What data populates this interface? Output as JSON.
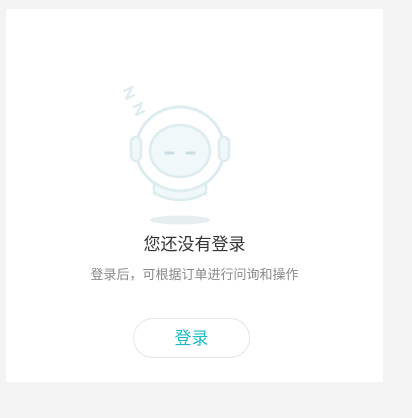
{
  "empty_state": {
    "illustration": "sleeping-robot-icon",
    "title": "您还没有登录",
    "description": "登录后，可根据订单进行问询和操作",
    "login_label": "登录"
  },
  "colors": {
    "accent": "#21b9c7",
    "illustration_stroke": "#dcecef",
    "illustration_fill": "#f0f8f9"
  }
}
